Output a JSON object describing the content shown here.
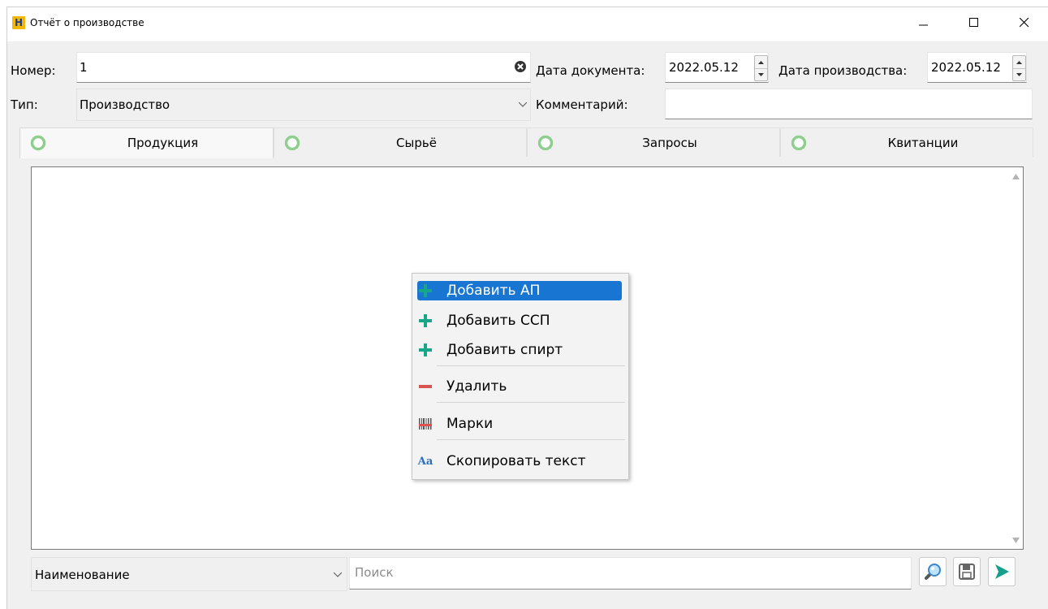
{
  "window": {
    "title": "Отчёт о производстве",
    "logo_letter": "H",
    "accent_color": "#1876d2"
  },
  "form": {
    "number_label": "Номер:",
    "number_value": "1",
    "doc_date_label": "Дата документа:",
    "doc_date_value": "2022.05.12",
    "prod_date_label": "Дата производства:",
    "prod_date_value": "2022.05.12",
    "type_label": "Тип:",
    "type_value": "Производство",
    "comment_label": "Комментарий:",
    "comment_value": ""
  },
  "tabs": [
    {
      "label": "Продукция",
      "active": true,
      "icon": "status-circle-icon"
    },
    {
      "label": "Сырьё",
      "active": false,
      "icon": "status-circle-icon"
    },
    {
      "label": "Запросы",
      "active": false,
      "icon": "status-circle-icon"
    },
    {
      "label": "Квитанции",
      "active": false,
      "icon": "status-circle-icon"
    }
  ],
  "context_menu": {
    "items": [
      {
        "label": "Добавить АП",
        "icon": "plus-icon",
        "selected": true
      },
      {
        "label": "Добавить ССП",
        "icon": "plus-icon",
        "selected": false
      },
      {
        "label": "Добавить спирт",
        "icon": "plus-icon",
        "selected": false
      },
      {
        "label": "Удалить",
        "icon": "minus-icon",
        "selected": false
      },
      {
        "label": "Марки",
        "icon": "barcode-icon",
        "selected": false
      },
      {
        "label": "Скопировать текст",
        "icon": "text-aa-icon",
        "selected": false
      }
    ],
    "aa_glyph": "Aa"
  },
  "bottom": {
    "field_combo_value": "Наименование",
    "search_placeholder": "Поиск"
  }
}
